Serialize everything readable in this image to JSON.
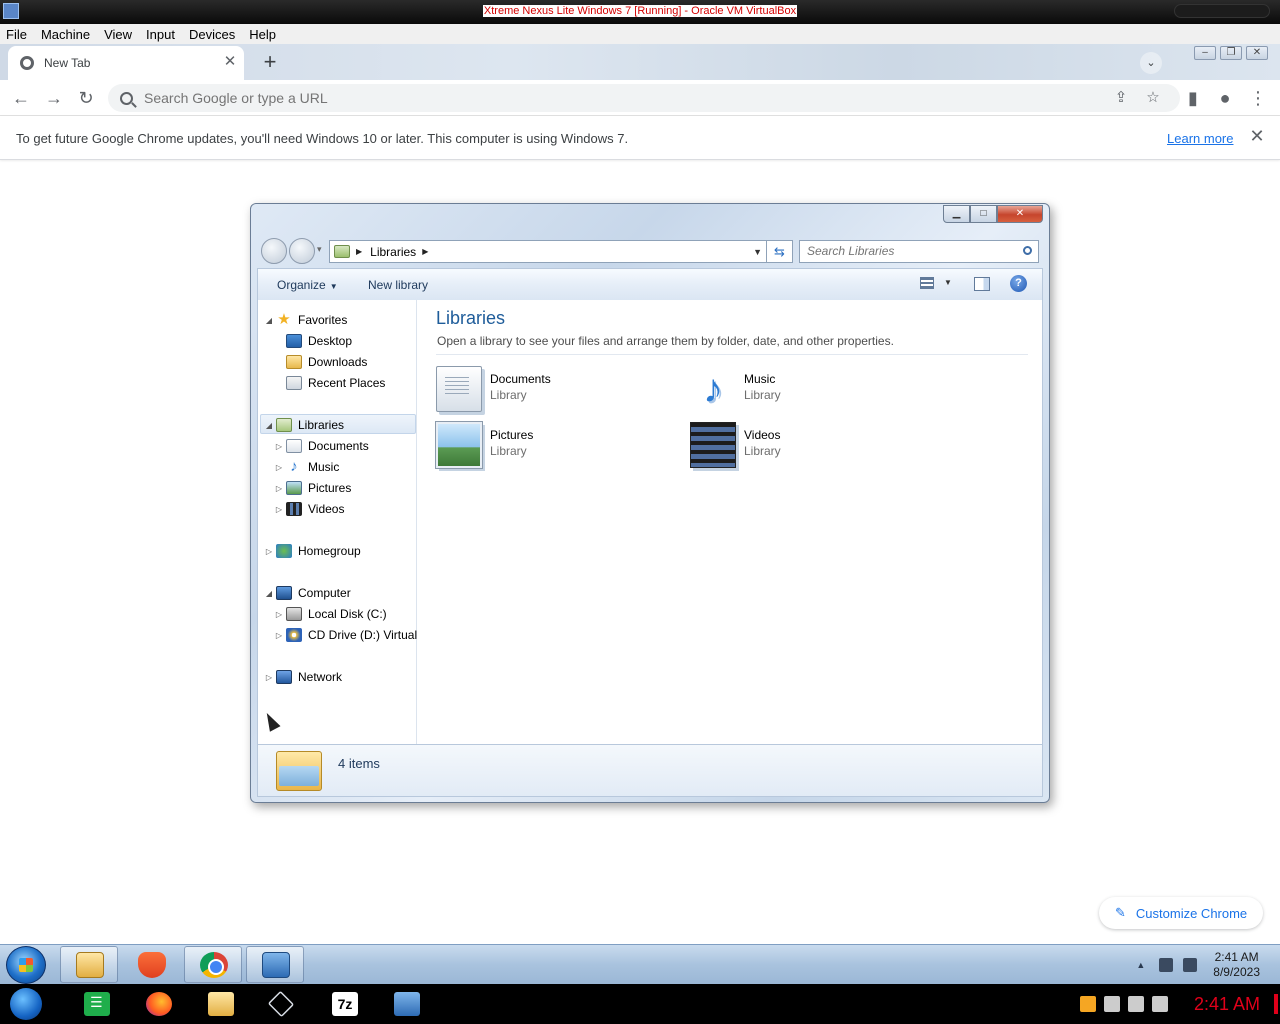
{
  "vbox": {
    "title": "Xtreme Nexus Lite Windows 7 [Running] - Oracle VM VirtualBox",
    "menu": [
      "File",
      "Machine",
      "View",
      "Input",
      "Devices",
      "Help"
    ]
  },
  "chrome": {
    "tab_title": "New Tab",
    "tab_close": "✕",
    "new_tab": "+",
    "omnibox_placeholder": "Search Google or type a URL",
    "infobar_message": "To get future Google Chrome updates, you'll need Windows 10 or later. This computer is using Windows 7.",
    "infobar_link": "Learn more",
    "infobar_close": "✕",
    "customize_label": "Customize Chrome"
  },
  "explorer": {
    "breadcrumb": "Libraries",
    "search_placeholder": "Search Libraries",
    "commands": {
      "organize": "Organize",
      "new_library": "New library"
    },
    "nav": {
      "favorites": "Favorites",
      "desktop": "Desktop",
      "downloads": "Downloads",
      "recent_places": "Recent Places",
      "libraries": "Libraries",
      "documents": "Documents",
      "music": "Music",
      "pictures": "Pictures",
      "videos": "Videos",
      "homegroup": "Homegroup",
      "computer": "Computer",
      "local_disk": "Local Disk (C:)",
      "cd_drive": "CD Drive (D:) Virtual",
      "network": "Network"
    },
    "heading": "Libraries",
    "subheading": "Open a library to see your files and arrange them by folder, date, and other properties.",
    "libraries": [
      {
        "name": "Documents",
        "kind": "Library",
        "icon": "documents-library-icon"
      },
      {
        "name": "Music",
        "kind": "Library",
        "icon": "music-library-icon"
      },
      {
        "name": "Pictures",
        "kind": "Library",
        "icon": "pictures-library-icon"
      },
      {
        "name": "Videos",
        "kind": "Library",
        "icon": "videos-library-icon"
      }
    ],
    "item_count": "4 items"
  },
  "guest_taskbar": {
    "time": "2:41 AM",
    "date": "8/9/2023"
  },
  "host_taskbar": {
    "time": "2:41 AM"
  }
}
